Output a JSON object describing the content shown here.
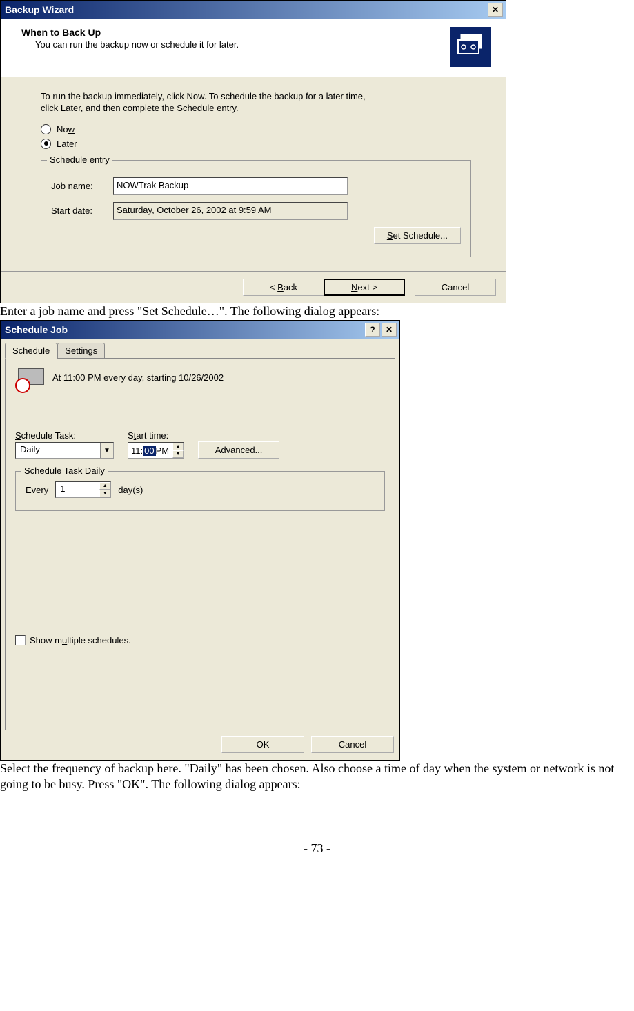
{
  "dialog1": {
    "title": "Backup Wizard",
    "header_title": "When to Back Up",
    "header_sub": "You can run the backup now or schedule it for later.",
    "body_text": "To run the backup immediately, click Now. To schedule the backup for a later time, click Later, and then complete the Schedule entry.",
    "radio_now": "Now",
    "radio_later": "Later",
    "group_legend": "Schedule entry",
    "job_label": "Job name:",
    "job_value": "NOWTrak Backup",
    "start_label": "Start date:",
    "start_value": "Saturday, October 26, 2002 at 9:59 AM",
    "set_schedule_btn": "Set Schedule...",
    "back_btn": "< Back",
    "next_btn": "Next >",
    "cancel_btn": "Cancel"
  },
  "instruction1": "Enter a job name and press \"Set Schedule…\".  The following dialog appears:",
  "dialog2": {
    "title": "Schedule Job",
    "tab_schedule": "Schedule",
    "tab_settings": "Settings",
    "summary": "At 11:00 PM every day, starting 10/26/2002",
    "schedule_task_label": "Schedule Task:",
    "schedule_task_value": "Daily",
    "start_time_label": "Start time:",
    "start_time_hour": "11:",
    "start_time_min": "00",
    "start_time_ampm": " PM",
    "advanced_btn": "Advanced...",
    "daily_legend": "Schedule Task Daily",
    "every_label": "Every",
    "every_value": "1",
    "days_label": "day(s)",
    "show_multiple": "Show multiple schedules.",
    "ok_btn": "OK",
    "cancel_btn": "Cancel"
  },
  "instruction2": "Select the frequency of backup here.  \"Daily\" has been chosen.  Also choose a time of day when the system or network is not going to be busy. Press \"OK\".  The following dialog appears:",
  "page_number": "- 73 -"
}
